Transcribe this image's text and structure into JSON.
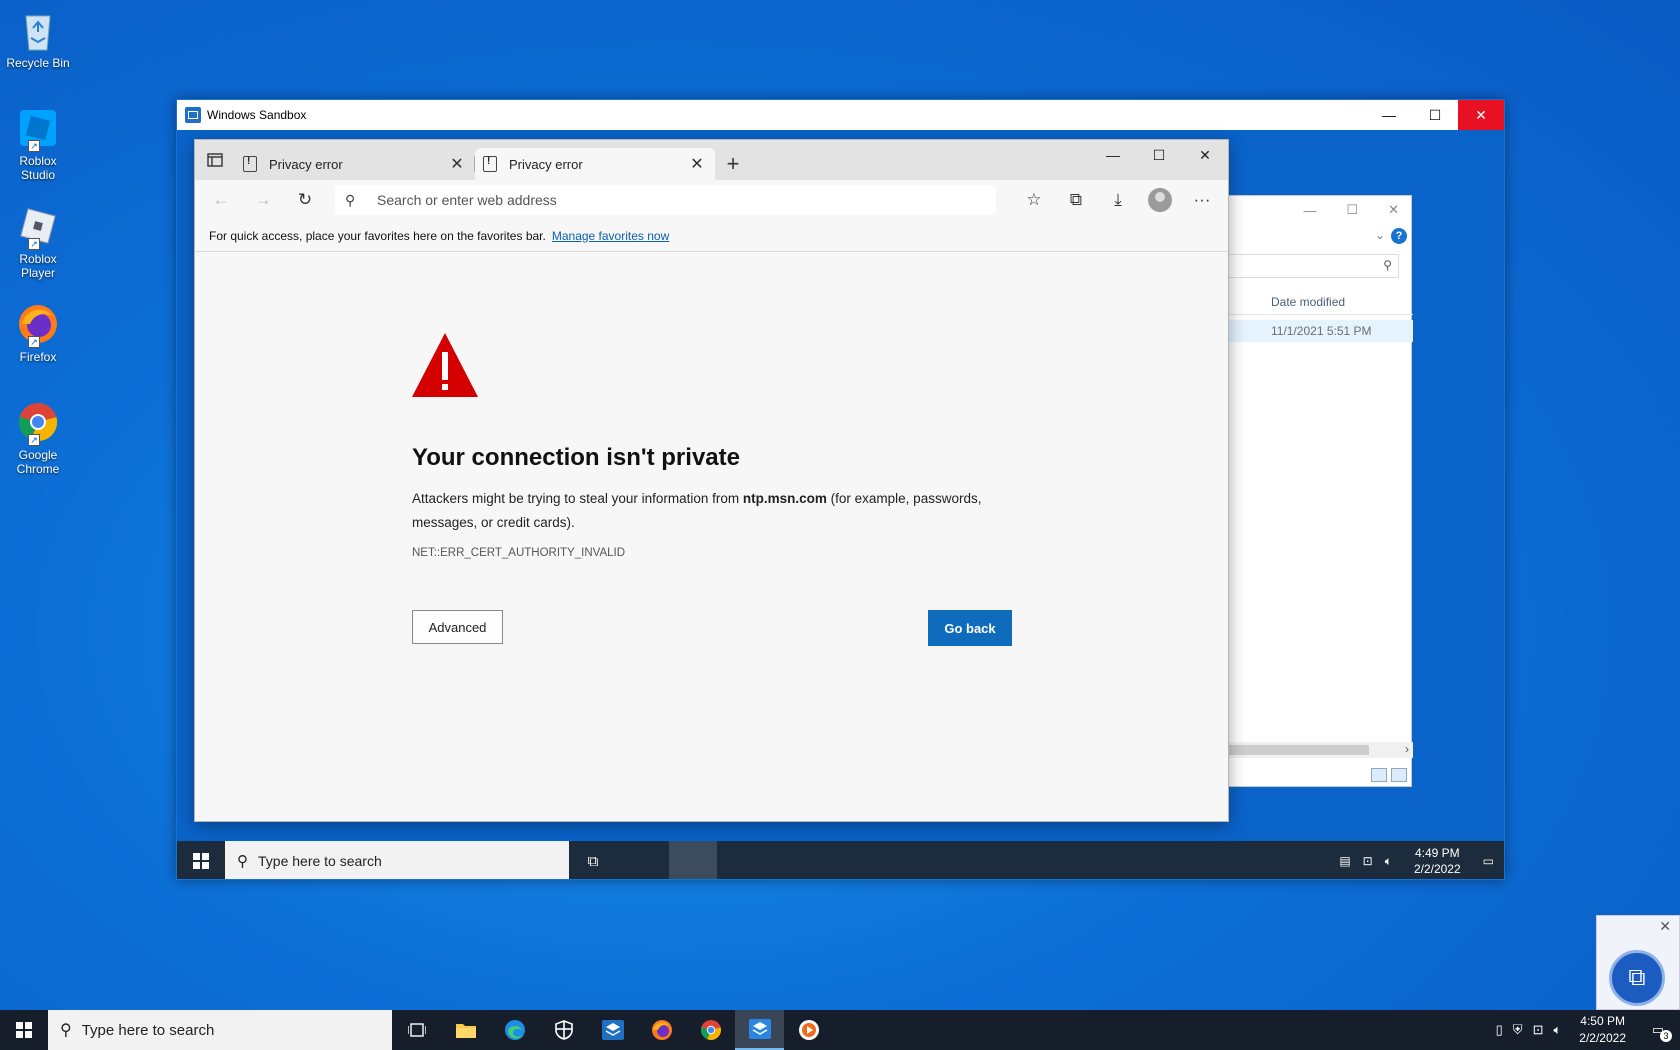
{
  "desktop": {
    "icons": [
      {
        "label": "Recycle Bin"
      },
      {
        "label": "Roblox Studio"
      },
      {
        "label": "Roblox Player"
      },
      {
        "label": "Firefox"
      },
      {
        "label": "Google Chrome"
      }
    ]
  },
  "sandbox": {
    "title": "Windows Sandbox",
    "controls": {
      "minimize": "—",
      "maximize": "☐",
      "close": "✕"
    }
  },
  "explorer": {
    "column_header": "Date modified",
    "row_date": "11/1/2021 5:51 PM"
  },
  "browser": {
    "tabs": [
      {
        "title": "Privacy error",
        "active": false
      },
      {
        "title": "Privacy error",
        "active": true
      }
    ],
    "address_placeholder": "Search or enter web address",
    "favorites_bar_text": "For quick access, place your favorites here on the favorites bar.",
    "favorites_bar_link": "Manage favorites now",
    "error": {
      "title": "Your connection isn't private",
      "desc_before": "Attackers might be trying to steal your information from ",
      "domain": "ntp.msn.com",
      "desc_after": " (for example, passwords, messages, or credit cards).",
      "code": "NET::ERR_CERT_AUTHORITY_INVALID",
      "advanced_label": "Advanced",
      "goback_label": "Go back"
    }
  },
  "inner_taskbar": {
    "search_placeholder": "Type here to search",
    "time": "4:49 PM",
    "date": "2/2/2022"
  },
  "taskbar": {
    "search_placeholder": "Type here to search",
    "time": "4:50 PM",
    "date": "2/2/2022",
    "notification_count": "3"
  },
  "colors": {
    "accent": "#0f6cbd",
    "warning_red": "#d40000",
    "close_red": "#e81123"
  }
}
